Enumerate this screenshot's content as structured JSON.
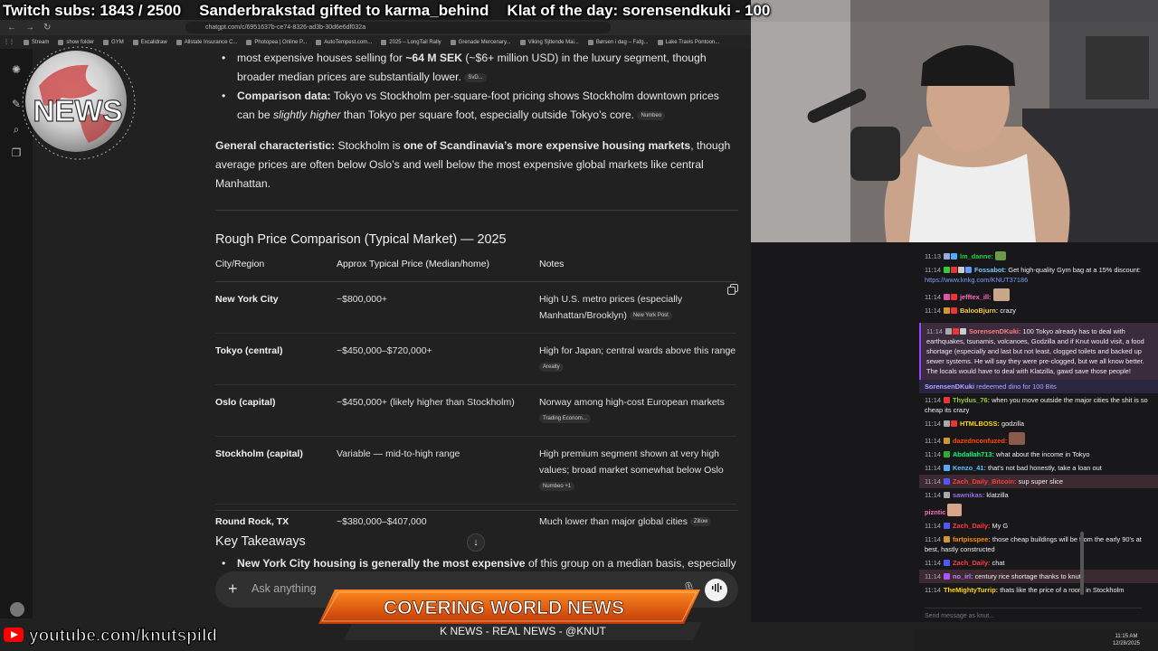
{
  "overlay": {
    "subs": "Twitch subs: 1843 / 2500",
    "gift": "Sanderbrakstad gifted to karma_behind",
    "klat": "Klat of the day: sorensendkuki - 100"
  },
  "browser": {
    "url": "chatgpt.com/c/6951637b-ce74-8326-ad3b-30d6e6df032a",
    "bookmarks": [
      "Stream",
      "show folder",
      "GYM",
      "Excalidraw",
      "Allstate Insurance C...",
      "Photopea | Online P...",
      "AutoTempest.com...",
      "2025 – LongTail Rally",
      "Grenade Mercenary...",
      "Viking Sjttende Mai...",
      "Børsen i dag – Fafg...",
      "Lake Travis Pontoon..."
    ]
  },
  "content": {
    "bullet1_tail": "most expensive houses selling for",
    "bullet1_bold": "~64 M SEK",
    "bullet1_after": "(~$6+ million USD) in the luxury segment, though broader median prices are substantially lower.",
    "bullet1_src": "SvD...",
    "bullet2_label": "Comparison data:",
    "bullet2_text1": "Tokyo vs Stockholm per-square-foot pricing shows Stockholm downtown prices can be",
    "bullet2_italic": "slightly higher",
    "bullet2_text2": "than Tokyo per square foot, especially outside Tokyo’s core.",
    "bullet2_src": "Numbeo",
    "general_label": "General characteristic:",
    "general_text1": "Stockholm is",
    "general_bold": "one of Scandinavia’s more expensive housing markets",
    "general_text2": ", though average prices are often below Oslo’s and well below the most expensive global markets like central Manhattan.",
    "table_title": "Rough Price Comparison (Typical Market) — 2025",
    "table_headers": [
      "City/Region",
      "Approx Typical Price (Median/home)",
      "Notes"
    ],
    "rows": [
      {
        "city": "New York City",
        "price": "~$800,000+",
        "notes": "High U.S. metro prices (especially Manhattan/Brooklyn)",
        "src": "New York Post"
      },
      {
        "city": "Tokyo (central)",
        "price": "~$450,000–$720,000+",
        "notes": "High for Japan; central wards above this range",
        "src": "Arealty"
      },
      {
        "city": "Oslo (capital)",
        "price": "~$450,000+ (likely higher than Stockholm)",
        "notes": "Norway among high-cost European markets",
        "src": "Trading Econom..."
      },
      {
        "city": "Stockholm (capital)",
        "price": "Variable — mid-to-high range",
        "notes": "High premium segment shown at very high values; broad market somewhat below Oslo",
        "src": "Numbeo +1"
      },
      {
        "city": "Round Rock, TX",
        "price": "~$380,000–$407,000",
        "notes": "Much lower than major global cities",
        "src": "Zillow"
      }
    ],
    "key_title": "Key Takeaways",
    "key_bold": "New York City housing is generally the most expensive",
    "key_text": "of this group on a median basis, especially in",
    "composer_placeholder": "Ask anything"
  },
  "news": {
    "logo_text": "NEWS",
    "covering": "COVERING WORLD NEWS",
    "kbar": "K NEWS - REAL NEWS - @KNUT",
    "youtube": "youtube.com/knutspild"
  },
  "chat": {
    "messages": [
      {
        "t": "11:13",
        "user": "lm_danne:",
        "color": "#1fd13b",
        "text": "",
        "style": ""
      },
      {
        "t": "11:14",
        "user": "Fossabot:",
        "color": "#7cc5ff",
        "text": "Get high-quality Gym bag at a 15% discount:",
        "link": "https://www.knkg.com/KNUT37186",
        "style": ""
      },
      {
        "t": "11:14",
        "user": "jefftex_ill:",
        "color": "#ff69b4",
        "text": "",
        "style": ""
      },
      {
        "t": "11:14",
        "user": "BalooBjurn:",
        "color": "#f2c94c",
        "text": "crazy",
        "style": ""
      },
      {
        "t": "11:14",
        "user": "SorensenDKuki:",
        "color": "#ff7f7f",
        "text": "100 Tokyo already has to deal with earthquakes, tsunamis, volcanoes, Godzilla and if Knut would visit, a food shortage (especially and last but not least, clogged toilets and backed up sewer systems. He will say they were pre-clogged, but we all know better. The locals would have to deal with Klatzilla, gawd save those people!",
        "style": "hl"
      },
      {
        "t": "",
        "user": "SorensenDKuki",
        "color": "#b9a3ff",
        "text": "redeemed dino for 100 Bits",
        "style": "sys"
      },
      {
        "t": "11:14",
        "user": "Thydus_76:",
        "color": "#9acd32",
        "text": "when you move outside the major cities the shit is so cheap its crazy",
        "style": ""
      },
      {
        "t": "11:14",
        "user": "HTMLBOSS:",
        "color": "#ffd700",
        "text": "godzilla",
        "style": ""
      },
      {
        "t": "11:14",
        "user": "dazednconfuzed:",
        "color": "#ff4500",
        "text": "",
        "style": ""
      },
      {
        "t": "11:14",
        "user": "Abdallah713:",
        "color": "#00ff7f",
        "text": "what about the income in Tokyo",
        "style": ""
      },
      {
        "t": "11:14",
        "user": "Kenzo_41:",
        "color": "#5ec2ff",
        "text": "that's not bad honestly, take a loan out",
        "style": ""
      },
      {
        "t": "11:14",
        "user": "Zach_Daily_Bitcoin:",
        "color": "#ff3b3b",
        "text": "sup super slice",
        "style": "hl2"
      },
      {
        "t": "11:14",
        "user": "sawnikas:",
        "color": "#9370db",
        "text": "klatzilla",
        "style": ""
      },
      {
        "t": "",
        "user": "pizntic",
        "color": "#ff69b4",
        "text": "",
        "style": ""
      },
      {
        "t": "11:14",
        "user": "Zach_Daily:",
        "color": "#ff3b3b",
        "text": "My G",
        "style": ""
      },
      {
        "t": "11:14",
        "user": "fartpisspee:",
        "color": "#ff8c00",
        "text": "those cheap buildings will be from the early 90's at best, hastly constructed",
        "style": ""
      },
      {
        "t": "11:14",
        "user": "Zach_Daily:",
        "color": "#ff3b3b",
        "text": "chat",
        "style": ""
      },
      {
        "t": "11:14",
        "user": "no_irl:",
        "color": "#c084fc",
        "text": "century rice shortage thanks to knut",
        "style": "hl2"
      },
      {
        "t": "11:14",
        "user": "TheMightyTurrip:",
        "color": "#ffd700",
        "text": "thats like the price of a room in Stockholm",
        "style": ""
      }
    ],
    "input_placeholder": "Send message as knut..."
  },
  "taskbar": {
    "time": "11:15 AM",
    "date": "12/28/2025"
  }
}
